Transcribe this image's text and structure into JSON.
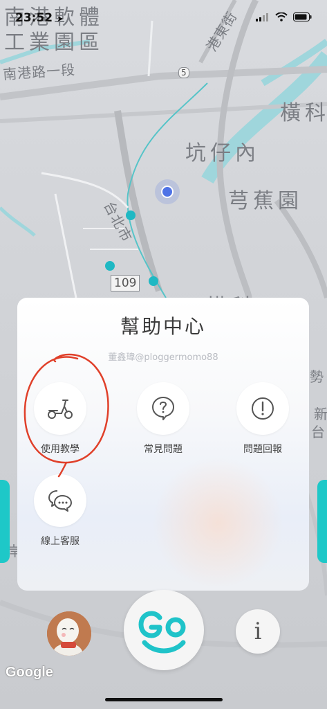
{
  "status_bar": {
    "time": "23:52",
    "location_arrow_icon": "location-arrow-icon",
    "signal_icon": "cellular-signal-icon",
    "wifi_icon": "wifi-icon",
    "battery_icon": "battery-icon"
  },
  "map": {
    "labels": {
      "district_line1": "南港軟體",
      "district_line2": "工業園區",
      "road_nangang": "南港路一段",
      "street_gangdong": "港東街",
      "area_hengke_top": "橫科",
      "area_kengzainei": "坑仔內",
      "area_qianjiaoyuan": "芎蕉園",
      "city_taipei": "台北市",
      "road_badge_109": "109",
      "road_badge_5": "5",
      "partial_bottom": "橫科",
      "partial_right_1": "勢",
      "partial_right_2": "新",
      "partial_right_3": "台",
      "partial_left": "岸"
    },
    "accent_color": "#1fb8c3",
    "water_color": "#9fd6dc"
  },
  "help_center": {
    "title": "幫助中心",
    "watermark": "董鑫瑋@ploggermomo88",
    "options": [
      {
        "label": "使用教學",
        "icon": "scooter-icon"
      },
      {
        "label": "常見問題",
        "icon": "question-bubble-icon"
      },
      {
        "label": "問題回報",
        "icon": "exclamation-circle-icon"
      },
      {
        "label": "線上客服",
        "icon": "chat-bubbles-icon"
      }
    ],
    "annotation_color": "#e0402a"
  },
  "bottom_bar": {
    "avatar_icon": "user-avatar",
    "go_label": "Go",
    "go_color": "#1fc3c9",
    "info_label": "i",
    "google_logo": "Google"
  }
}
